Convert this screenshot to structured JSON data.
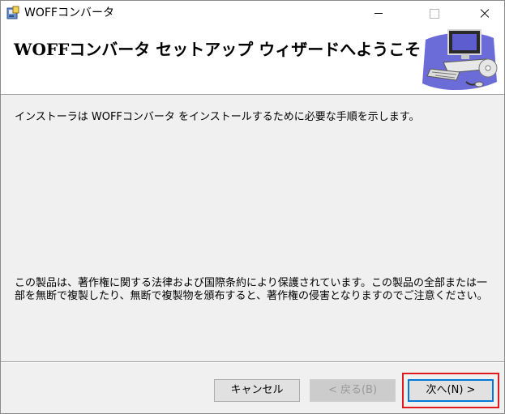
{
  "window": {
    "title": "WOFFコンバータ",
    "app_icon": "installer-icon",
    "controls": [
      "minimize-icon",
      "maximize-icon",
      "close-icon"
    ]
  },
  "banner": {
    "title": "WOFFコンバータ セットアップ ウィザードへようこそ",
    "art_icon": "computer-setup-icon"
  },
  "body": {
    "intro": "インストーラは WOFFコンバータ をインストールするために必要な手順を示します。",
    "notice": "この製品は、著作権に関する法律および国際条約により保護されています。この製品の全部または一部を無断で複製したり、無断で複製物を頒布すると、著作権の侵害となりますのでご注意ください。"
  },
  "buttons": {
    "cancel": "キャンセル",
    "back": "< 戻る(B)",
    "next": "次へ(N) >"
  },
  "colors": {
    "focus_border": "#0078d7",
    "highlight_box": "#e0191c"
  }
}
